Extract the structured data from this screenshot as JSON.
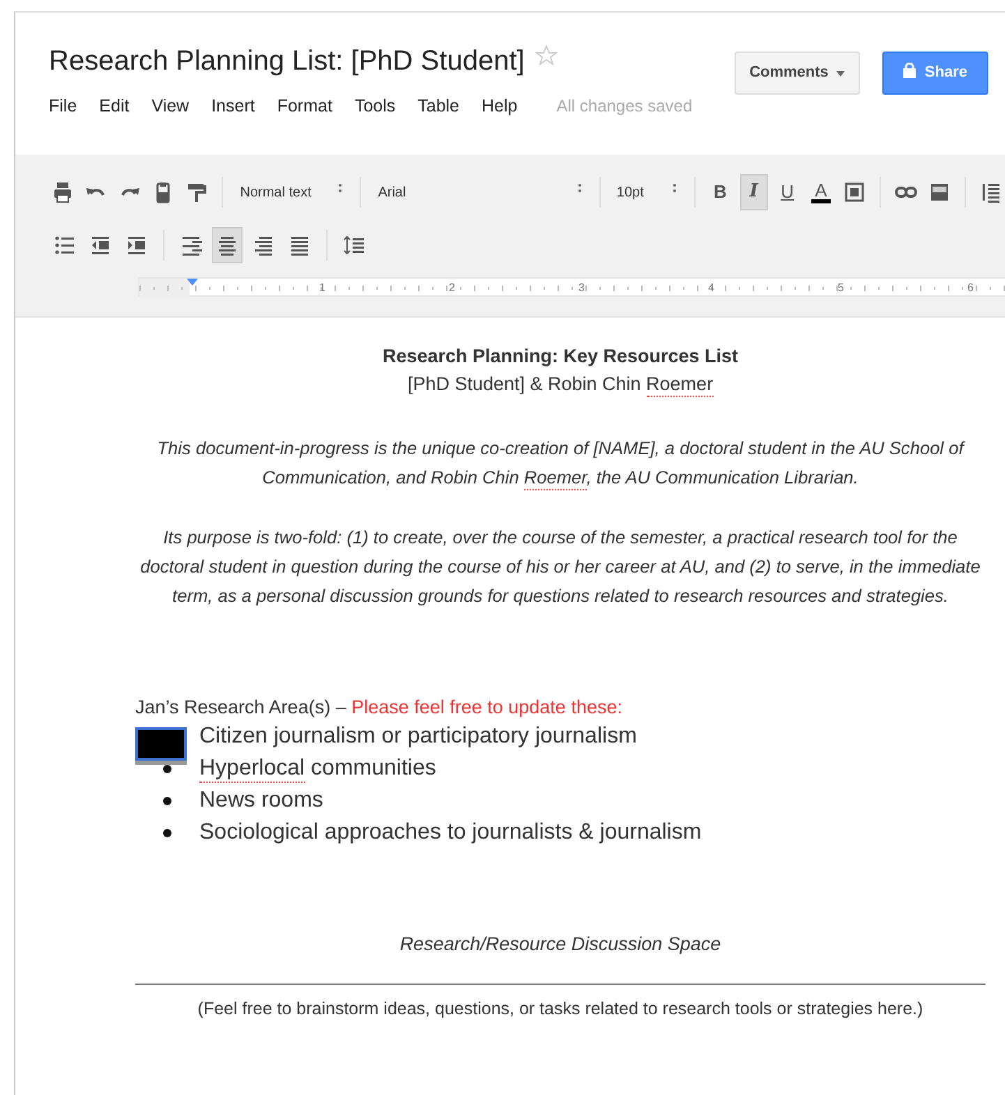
{
  "document_title": "Research Planning List: [PhD Student]",
  "starred": false,
  "header_buttons": [
    {
      "label": "Comments",
      "kind": "dropdown"
    },
    {
      "label": "Share",
      "kind": "primary"
    }
  ],
  "menu": [
    "File",
    "Edit",
    "View",
    "Insert",
    "Format",
    "Tools",
    "Table",
    "Help"
  ],
  "save_status": "All changes saved",
  "toolbar": {
    "style": "Normal text",
    "font": "Arial",
    "size": "10pt",
    "format_buttons": [
      {
        "label": "B",
        "selected": false
      },
      {
        "label": "I",
        "selected": true
      },
      {
        "label": "U",
        "selected": false
      }
    ],
    "text_color": {
      "label": "A",
      "color": "#000000"
    },
    "alignment": [
      {
        "selected": false
      },
      {
        "selected": true
      },
      {
        "selected": false
      },
      {
        "selected": false
      }
    ]
  },
  "ruler": [
    "1",
    "2",
    "3",
    "4",
    "5",
    "6"
  ],
  "body": [
    {
      "kind": "heading",
      "segments": [
        {
          "text": "Research Planning: Key Resources List",
          "flagged": false
        }
      ]
    },
    {
      "kind": "subheading",
      "segments": [
        {
          "text": "[PhD Student] & Robin Chin ",
          "flagged": false
        },
        {
          "text": "Roemer",
          "flagged": true
        }
      ]
    },
    {
      "kind": "intro",
      "segments": [
        {
          "text": "This document-in-progress is the unique co-creation of [NAME], a doctoral student in the AU School of Communication, and Robin Chin ",
          "flagged": false
        },
        {
          "text": "Roemer",
          "flagged": true
        },
        {
          "text": ", the AU Communication Librarian.",
          "flagged": false
        }
      ]
    },
    {
      "kind": "intro",
      "segments": [
        {
          "text": "Its purpose is two-fold: (1) to create, over the course of the semester, a practical research tool for the doctoral student in question during the course of his or her career at AU, and (2) to serve, in the immediate term, as a personal discussion grounds for questions related to research resources and strategies.",
          "flagged": false
        }
      ]
    }
  ],
  "research_areas": {
    "label": "Jan’s Research Area(s) – ",
    "note": "Please feel free to update these:",
    "items": [
      {
        "segments": [
          {
            "text": "Citizen journalism or participatory journalism",
            "flagged": false
          }
        ],
        "redacted": true
      },
      {
        "segments": [
          {
            "text": "Hyperlocal",
            "flagged": true
          },
          {
            "text": " communities",
            "flagged": false
          }
        ],
        "redacted": false
      },
      {
        "segments": [
          {
            "text": "News rooms",
            "flagged": false
          }
        ],
        "redacted": false
      },
      {
        "segments": [
          {
            "text": "Sociological approaches to journalists & journalism",
            "flagged": false
          }
        ],
        "redacted": false
      }
    ]
  },
  "discussion": {
    "heading": "Research/Resource Discussion Space",
    "prompt": "(Feel free to brainstorm ideas, questions, or tasks related to research tools or strategies here.)"
  }
}
